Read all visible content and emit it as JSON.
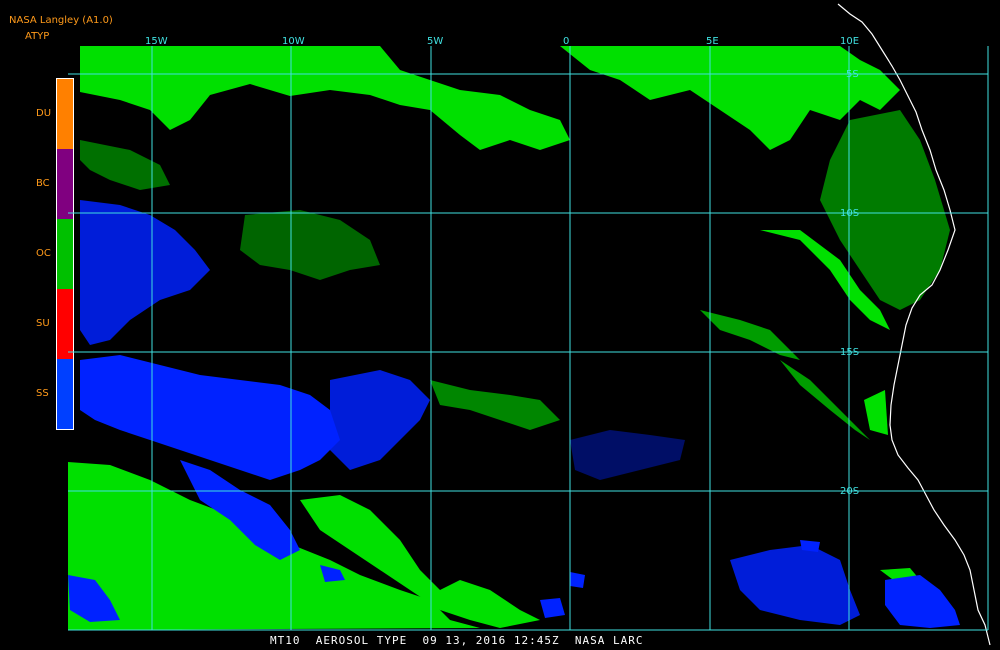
{
  "header": {
    "title": "NASA Langley (A1.0)",
    "product": "ATYP"
  },
  "legend": [
    {
      "code": "DU",
      "color": "#ff8000"
    },
    {
      "code": "BC",
      "color": "#800080"
    },
    {
      "code": "OC",
      "color": "#00c000"
    },
    {
      "code": "SU",
      "color": "#ff0000"
    },
    {
      "code": "SS",
      "color": "#0040ff"
    }
  ],
  "grid": {
    "color": "#40e0e0",
    "lon_labels": [
      "15W",
      "10W",
      "5W",
      "0",
      "5E",
      "10E"
    ],
    "lat_labels": [
      "5S",
      "10S",
      "15S",
      "20S"
    ]
  },
  "footer": {
    "text": "MT10  AEROSOL TYPE  09 13, 2016 12:45Z  NASA LARC"
  },
  "colors": {
    "oc": "#00e000",
    "ss": "#0022ff",
    "coast": "#ffffff",
    "background": "#000000",
    "label": "#ff9a1a"
  }
}
